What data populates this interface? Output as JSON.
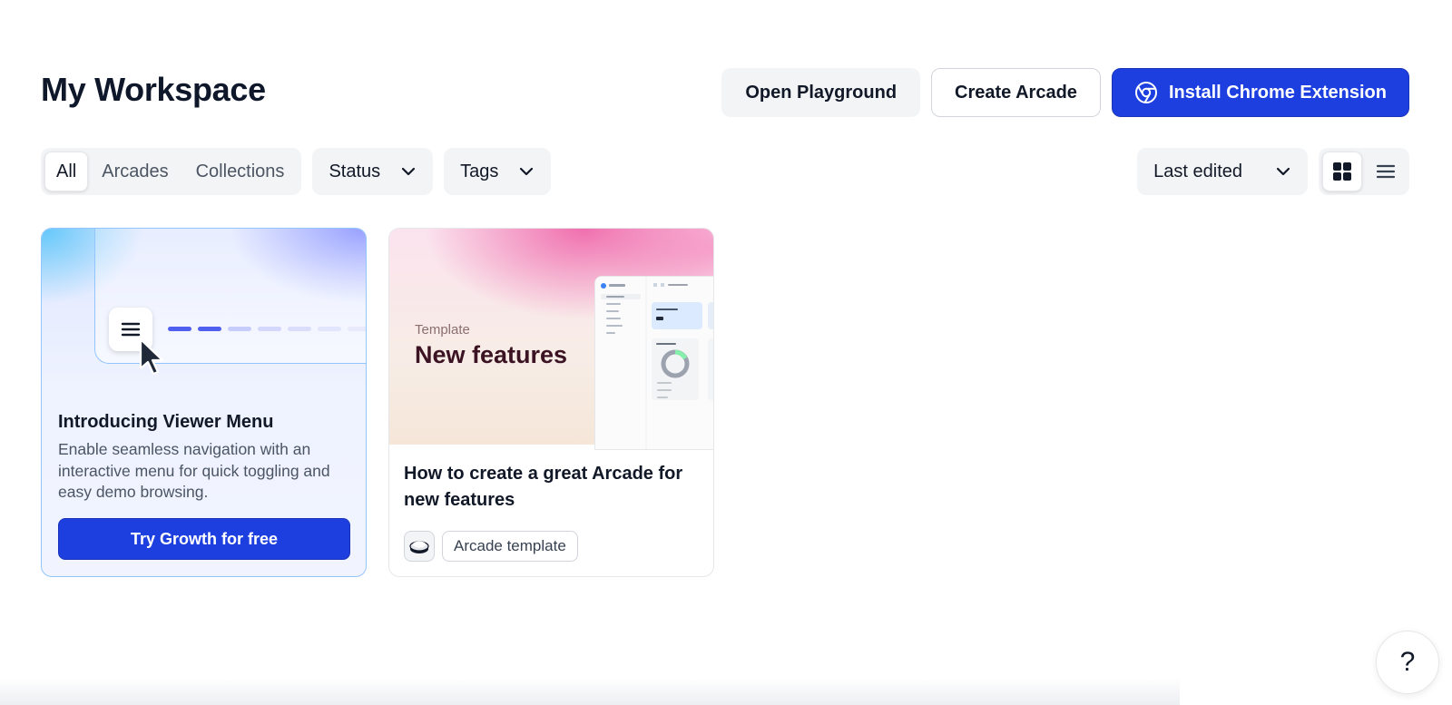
{
  "header": {
    "title": "My Workspace",
    "open_playground": "Open Playground",
    "create_arcade": "Create Arcade",
    "install_extension": "Install Chrome Extension"
  },
  "filters": {
    "tabs": [
      {
        "label": "All",
        "active": true
      },
      {
        "label": "Arcades",
        "active": false
      },
      {
        "label": "Collections",
        "active": false
      }
    ],
    "status_label": "Status",
    "tags_label": "Tags",
    "sort_label": "Last edited",
    "view_modes": [
      "grid-icon",
      "list-icon"
    ],
    "active_view": "grid"
  },
  "cards": {
    "promo": {
      "title": "Introducing Viewer Menu",
      "description": "Enable seamless navigation with an interactive menu for quick toggling and easy demo browsing.",
      "cta": "Try Growth for free"
    },
    "template": {
      "thumb_label": "Template",
      "thumb_heading": "New features",
      "title": "How to create a great Arcade for new features",
      "tag": "Arcade template"
    }
  },
  "help": {
    "label": "?"
  },
  "colors": {
    "primary": "#1d3fe0",
    "surface": "#f3f4f6",
    "text": "#111827"
  }
}
